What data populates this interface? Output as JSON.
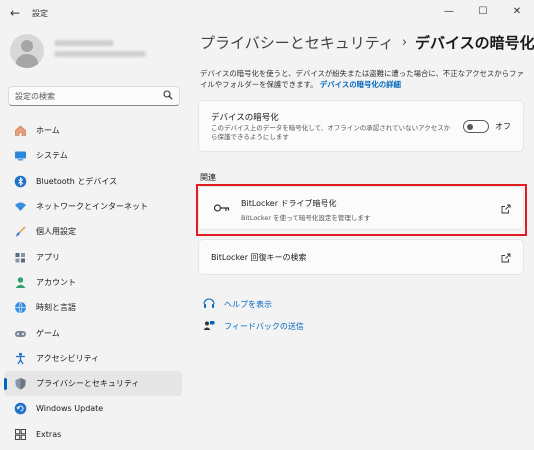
{
  "window": {
    "title": "設定"
  },
  "search": {
    "placeholder": "設定の検索"
  },
  "sidebar": {
    "items": [
      {
        "label": "ホーム",
        "icon": "home-icon"
      },
      {
        "label": "システム",
        "icon": "system-icon"
      },
      {
        "label": "Bluetooth とデバイス",
        "icon": "bluetooth-icon"
      },
      {
        "label": "ネットワークとインターネット",
        "icon": "wifi-icon"
      },
      {
        "label": "個人用設定",
        "icon": "brush-icon"
      },
      {
        "label": "アプリ",
        "icon": "apps-icon"
      },
      {
        "label": "アカウント",
        "icon": "account-icon"
      },
      {
        "label": "時刻と言語",
        "icon": "globe-clock-icon"
      },
      {
        "label": "ゲーム",
        "icon": "gamepad-icon"
      },
      {
        "label": "アクセシビリティ",
        "icon": "accessibility-icon"
      },
      {
        "label": "プライバシーとセキュリティ",
        "icon": "shield-icon",
        "active": true
      },
      {
        "label": "Windows Update",
        "icon": "update-icon"
      },
      {
        "label": "Extras",
        "icon": "extras-icon"
      }
    ]
  },
  "breadcrumb": {
    "parent": "プライバシーとセキュリティ",
    "separator": "›",
    "current": "デバイスの暗号化"
  },
  "description": {
    "text": "デバイスの暗号化を使うと、デバイスが紛失または盗難に遭った場合に、不正なアクセスからファイルやフォルダーを保護できます。",
    "link": "デバイスの暗号化の詳細"
  },
  "encryption": {
    "title": "デバイスの暗号化",
    "subtitle": "このデバイス上のデータを暗号化して、オフラインの承認されていないアクセスから保護できるようにします",
    "toggle_label": "オフ"
  },
  "related": {
    "heading": "関連",
    "bitlocker": {
      "title": "BitLocker ドライブ暗号化",
      "subtitle": "BitLocker を使って暗号化設定を管理します"
    },
    "recovery": {
      "title": "BitLocker 回復キーの検索"
    }
  },
  "help": {
    "get_help": "ヘルプを表示",
    "feedback": "フィードバックの送信"
  },
  "colors": {
    "accent": "#0067c0",
    "highlight": "#e21b23"
  }
}
